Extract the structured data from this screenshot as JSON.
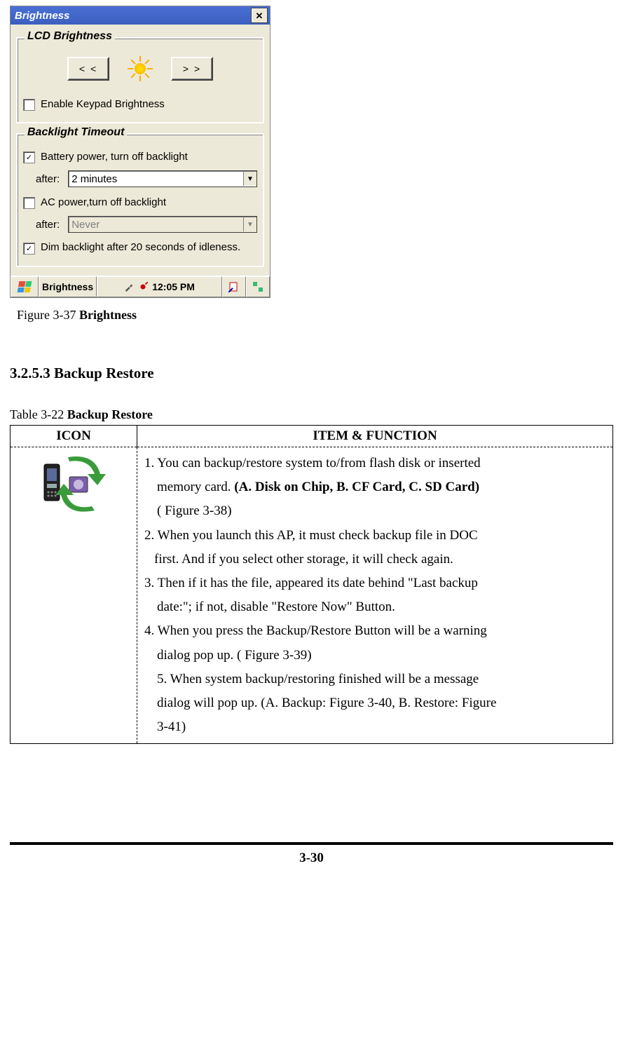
{
  "dialog": {
    "title": "Brightness",
    "close": "✕",
    "lcd": {
      "legend": "LCD Brightness",
      "prev": "< <",
      "next": "> >",
      "enable_keypad": "Enable Keypad Brightness",
      "enable_keypad_checked": false
    },
    "backlight": {
      "legend": "Backlight Timeout",
      "battery_label": "Battery power, turn off backlight",
      "battery_checked": true,
      "battery_after_label": "after:",
      "battery_after_value": "2 minutes",
      "ac_label": "AC  power,turn off backlight",
      "ac_checked": false,
      "ac_after_label": "after:",
      "ac_after_value": "Never",
      "dim_label": "Dim backlight after 20 seconds of idleness.",
      "dim_checked": true
    },
    "taskbar": {
      "app": "Brightness",
      "time": "12:05 PM"
    }
  },
  "figure_caption": {
    "prefix": "Figure 3-37 ",
    "bold": "Brightness"
  },
  "section_heading": "3.2.5.3 Backup Restore",
  "table_caption": {
    "prefix": "Table 3-22 ",
    "bold": "Backup Restore"
  },
  "table": {
    "header_icon": "ICON",
    "header_func": "ITEM & FUNCTION",
    "func": {
      "l1a": "1. You can backup/restore system to/from flash disk or inserted",
      "l1b_pre": "memory card. ",
      "l1b_bold": "(A. Disk on Chip, B. CF Card, C. SD Card)",
      "l1c": "( Figure 3-38)",
      "l2a": "2. When you launch this AP, it must check backup file in DOC",
      "l2b": "first. And if you select other storage, it will check again.",
      "l3a": "3. Then if it has the file, appeared its date behind \"Last backup",
      "l3b": "date:\"; if not, disable \"Restore Now\" Button.",
      "l4a": "4. When you press the Backup/Restore Button will be a warning",
      "l4b": "dialog pop up. ( Figure 3-39)",
      "l5a": "5. When system backup/restoring finished will be a message",
      "l5b": "dialog will pop up. (A. Backup: Figure 3-40, B. Restore: Figure",
      "l5c": "3-41)"
    }
  },
  "page_number": "3-30"
}
